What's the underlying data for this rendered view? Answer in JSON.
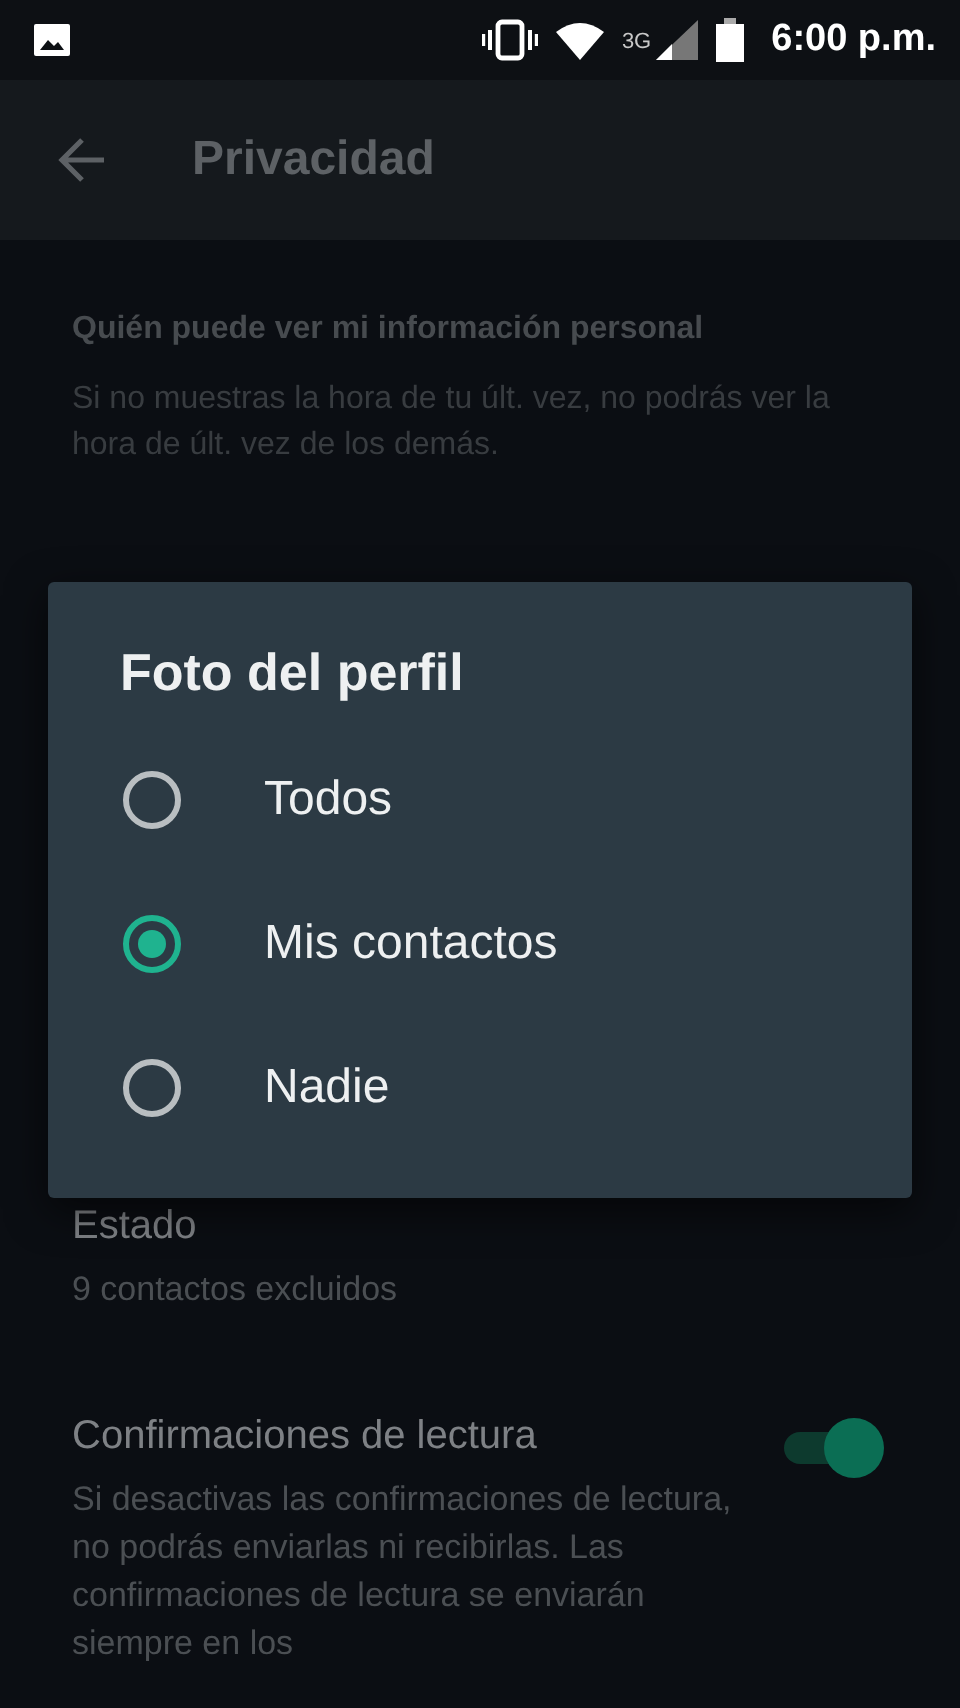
{
  "status_bar": {
    "network": "3G",
    "time": "6:00 p.m."
  },
  "app_bar": {
    "title": "Privacidad"
  },
  "section": {
    "header": "Quién puede ver mi información personal",
    "description": "Si no muestras la hora de tu últ. vez, no podrás ver la hora de últ. vez de los demás."
  },
  "settings": [
    {
      "kind": "item",
      "title": "Estado",
      "subtitle": "9 contactos excluidos"
    },
    {
      "kind": "toggle",
      "title": "Confirmaciones de lectura",
      "subtitle": "Si desactivas las confirmaciones de lectura, no podrás enviarlas ni recibirlas. Las confirmaciones de lectura se enviarán siempre en los",
      "on": true
    }
  ],
  "dialog": {
    "title": "Foto del perfil",
    "options": [
      {
        "label": "Todos",
        "selected": false
      },
      {
        "label": "Mis contactos",
        "selected": true
      },
      {
        "label": "Nadie",
        "selected": false
      }
    ]
  }
}
